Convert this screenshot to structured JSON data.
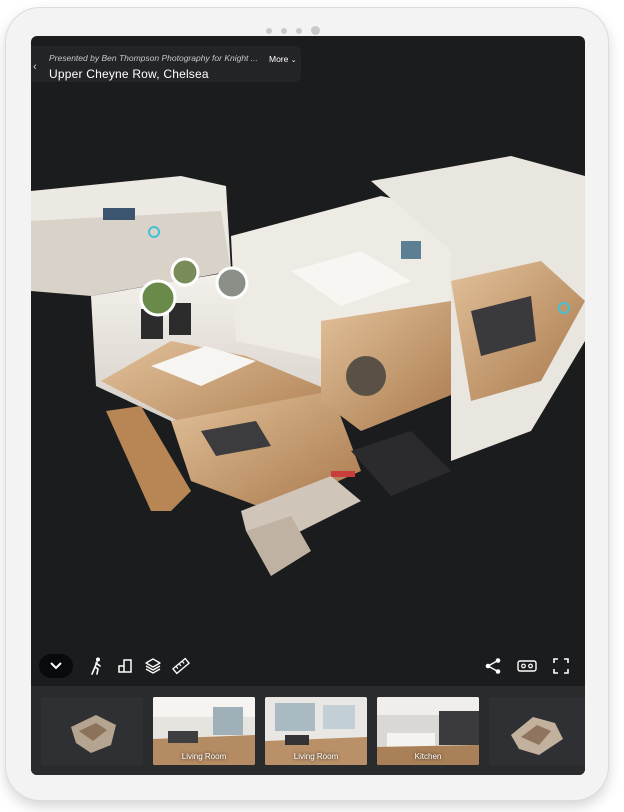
{
  "header": {
    "presenter_prefix": "Presented by",
    "presenter_name": "Ben Thompson Photography for Knight ...",
    "more_label": "More",
    "address": "Upper Cheyne Row, Chelsea"
  },
  "toolbar": {
    "left": [
      {
        "icon": "chevron-down-icon",
        "name": "collapse-button"
      },
      {
        "icon": "walking-person-icon",
        "name": "walkthrough-mode-button"
      },
      {
        "icon": "floor-plan-icon",
        "name": "floor-plan-button"
      },
      {
        "icon": "layers-icon",
        "name": "floor-selector-button"
      },
      {
        "icon": "ruler-icon",
        "name": "measurement-button"
      }
    ],
    "right": [
      {
        "icon": "share-icon",
        "name": "share-button"
      },
      {
        "icon": "vr-headset-icon",
        "name": "vr-button"
      },
      {
        "icon": "fullscreen-icon",
        "name": "fullscreen-button"
      }
    ]
  },
  "filmstrip": {
    "thumbnails": [
      {
        "label": "",
        "type": "dollhouse"
      },
      {
        "label": "Living Room",
        "type": "room"
      },
      {
        "label": "Living Room",
        "type": "room"
      },
      {
        "label": "Kitchen",
        "type": "room"
      },
      {
        "label": "",
        "type": "dollhouse"
      }
    ]
  },
  "colors": {
    "background": "#1b1c1e",
    "header_bg": "#242528",
    "filmstrip_bg": "#2a2b2d",
    "tag_accent": "#43c1d7"
  }
}
